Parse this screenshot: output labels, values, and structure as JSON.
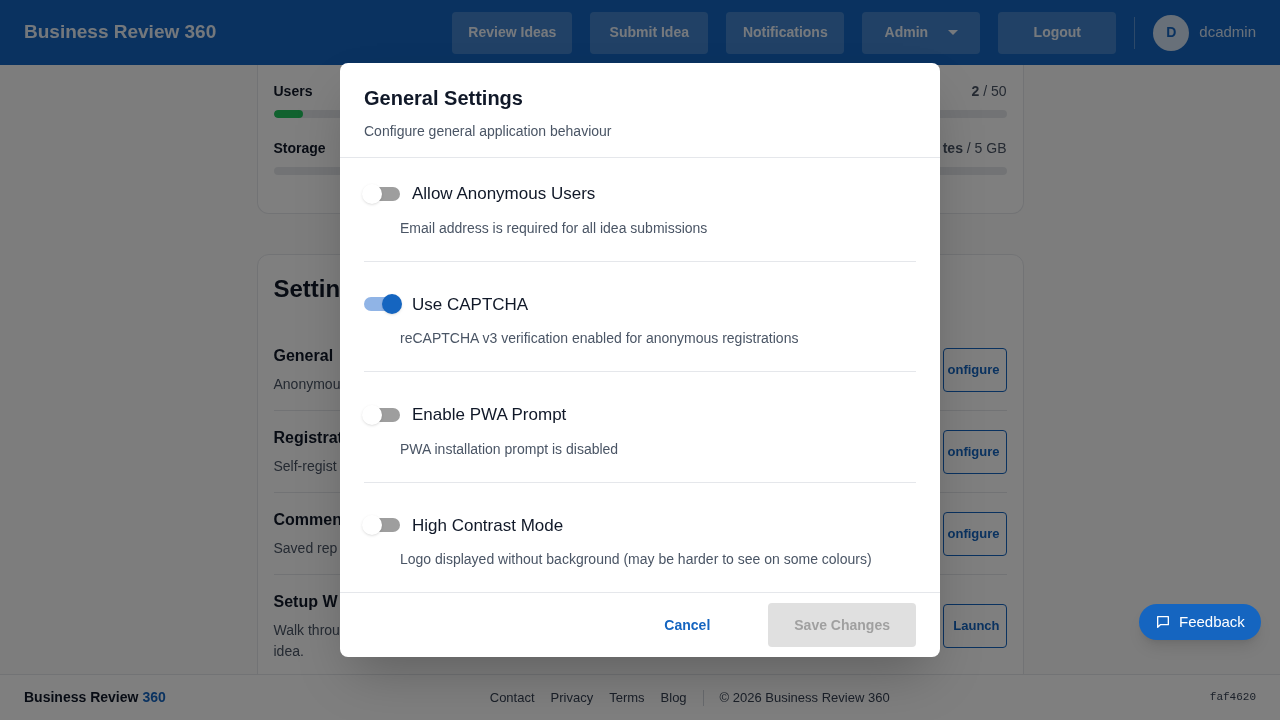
{
  "header": {
    "title": "Business Review 360",
    "nav": [
      {
        "label": "Review Ideas",
        "kind": "button"
      },
      {
        "label": "Submit Idea",
        "kind": "button"
      },
      {
        "label": "Notifications",
        "kind": "button"
      },
      {
        "label": "Admin",
        "kind": "dropdown"
      },
      {
        "label": "Logout",
        "kind": "button"
      }
    ],
    "user": {
      "initial": "D",
      "name": "dcadmin"
    }
  },
  "usage": [
    {
      "label": "Users",
      "reading": "**2** / 50",
      "level": 0.04
    },
    {
      "label": "Storage",
      "reading": "**tes** / 5 GB",
      "level": 0
    }
  ],
  "settings": {
    "title": "Settin",
    "items": [
      {
        "title": "General",
        "description": [
          "Anonymou"
        ],
        "action": "onfigure"
      },
      {
        "title": "Registrat",
        "description": [
          "Self-regist"
        ],
        "action": "onfigure"
      },
      {
        "title": "Commen",
        "description": [
          "Saved rep"
        ],
        "action": "onfigure"
      },
      {
        "title": "Setup W",
        "description": [
          "Walk throu",
          "idea."
        ],
        "action": "Launch"
      }
    ]
  },
  "dialog": {
    "title": "General Settings",
    "subtitle": "Configure general application behaviour",
    "options": [
      {
        "label": "Allow Anonymous Users",
        "description": "Email address is required for all idea submissions",
        "on": false
      },
      {
        "label": "Use CAPTCHA",
        "description": "reCAPTCHA v3 verification enabled for anonymous registrations",
        "on": true
      },
      {
        "label": "Enable PWA Prompt",
        "description": "PWA installation prompt is disabled",
        "on": false
      },
      {
        "label": "High Contrast Mode",
        "description": "Logo displayed without background (may be harder to see on some colours)",
        "on": false
      }
    ],
    "cancel": "Cancel",
    "save": {
      "label": "Save Changes",
      "disabled": true
    }
  },
  "feedback": "Feedback",
  "footer": {
    "brand": "Business Review",
    "brand_accent": "360",
    "links": [
      "Contact",
      "Privacy",
      "Terms",
      "Blog"
    ],
    "copyright": "© 2026 Business Review 360",
    "version": "faf4620"
  }
}
